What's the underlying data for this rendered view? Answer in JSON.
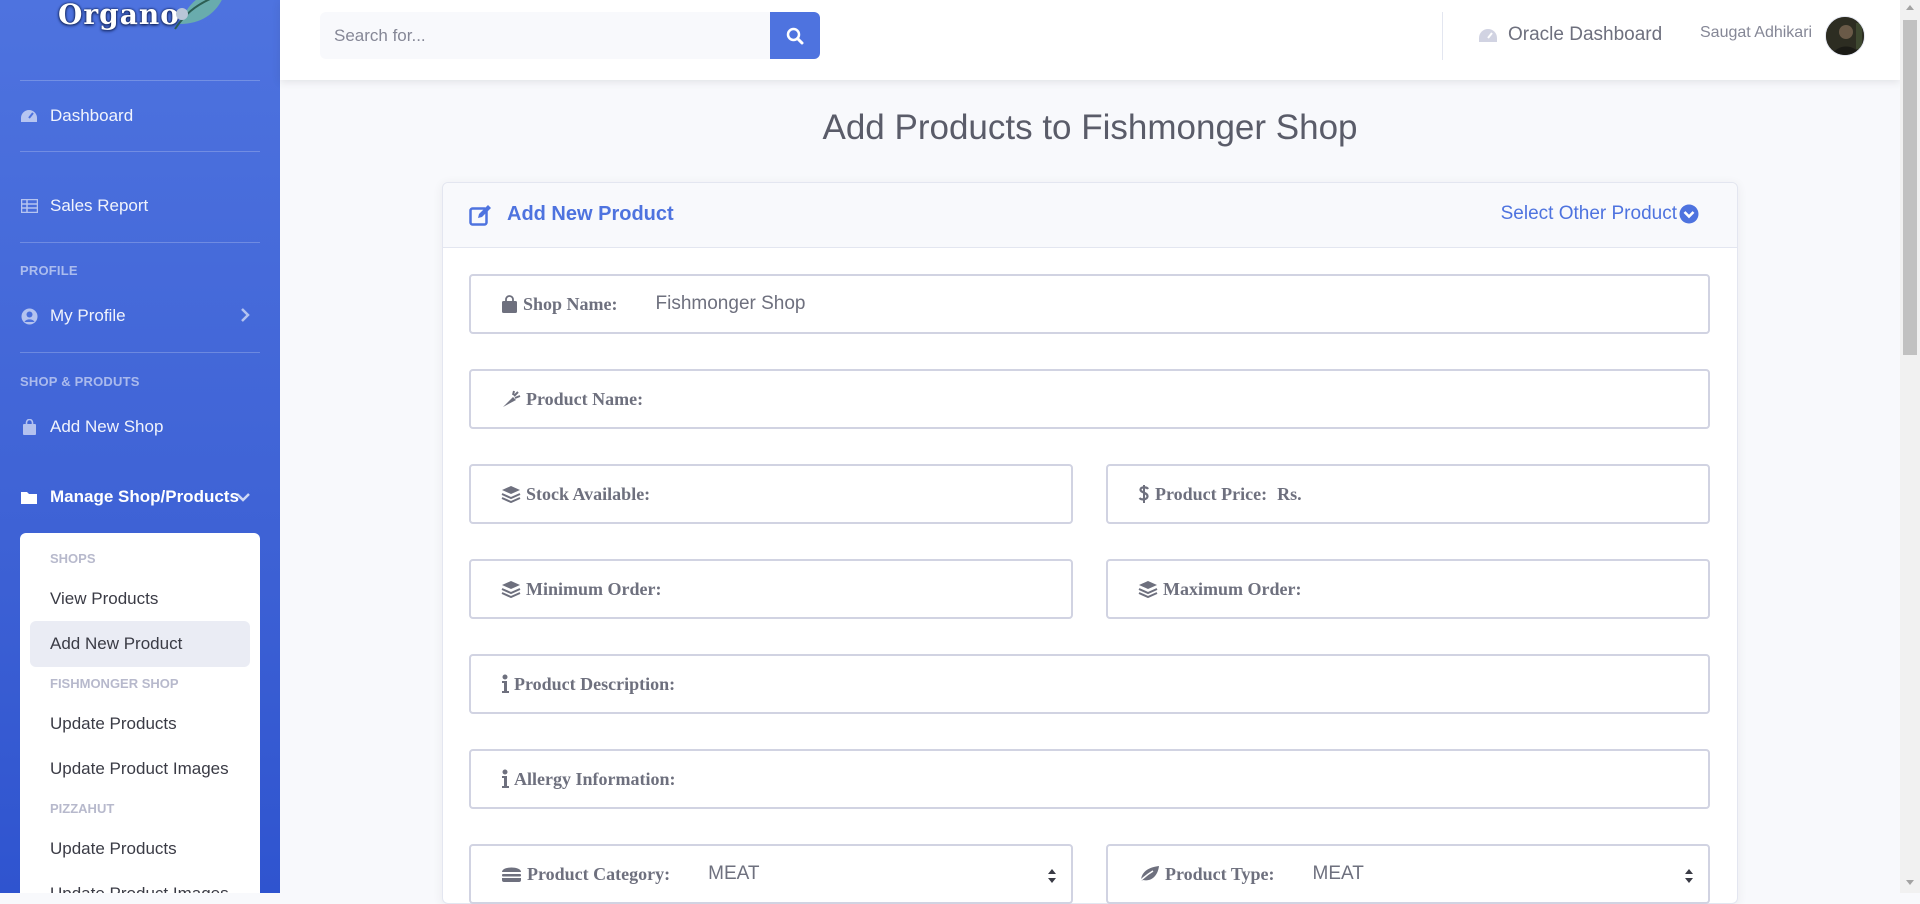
{
  "sidebar": {
    "brand": "Organo",
    "dashboard": "Dashboard",
    "sales_report": "Sales Report",
    "heading_profile": "PROFILE",
    "my_profile": "My Profile",
    "heading_shop": "SHOP & PRODUTS",
    "add_new_shop": "Add New Shop",
    "manage": "Manage Shop/Products",
    "collapse": {
      "shops_heading": "SHOPS",
      "view_products": "View Products",
      "add_new_product": "Add New Product",
      "fishmonger_heading": "FISHMONGER SHOP",
      "fm_update_products": "Update Products",
      "fm_update_images": "Update Product Images",
      "pizzahut_heading": "PIZZAHUT",
      "ph_update_products": "Update Products",
      "ph_update_images": "Update Product Images"
    }
  },
  "topbar": {
    "search_placeholder": "Search for...",
    "oracle_dashboard": "Oracle Dashboard",
    "user_name": "Saugat Adhikari"
  },
  "page": {
    "title": "Add Products to Fishmonger Shop"
  },
  "card": {
    "title": "Add New Product",
    "select_other": "Select Other Product"
  },
  "form": {
    "shop_name_label": "Shop Name:",
    "shop_name_value": "Fishmonger Shop",
    "product_name_label": "Product Name:",
    "stock_label": "Stock Available:",
    "price_label": "Product Price:",
    "price_currency": "Rs.",
    "min_order_label": "Minimum Order:",
    "max_order_label": "Maximum Order:",
    "description_label": "Product Description:",
    "allergy_label": "Allergy Information:",
    "category_label": "Product Category:",
    "category_value": "MEAT",
    "type_label": "Product Type:",
    "type_value": "MEAT"
  },
  "colors": {
    "primary": "#4e73df",
    "sidebar_bg": "#4e73df",
    "text_muted": "#858796",
    "border": "#d1d3e2"
  }
}
